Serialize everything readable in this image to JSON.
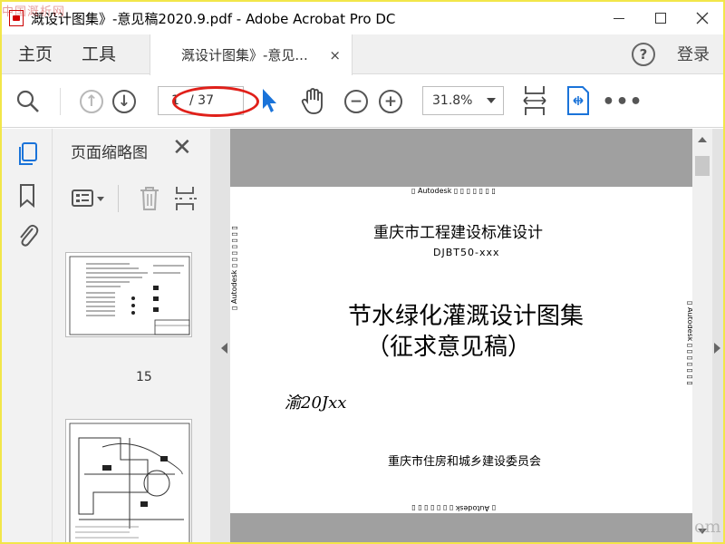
{
  "window": {
    "title": "溉设计图集》-意见稿2020.9.pdf - Adobe Acrobat Pro DC",
    "watermark": "中国溉析网"
  },
  "menubar": {
    "home": "主页",
    "tools": "工具",
    "tab_label": "溉设计图集》-意见...",
    "tab_close": "×",
    "help": "?",
    "login": "登录"
  },
  "toolbar": {
    "current_page": "1",
    "total_pages": "/ 37",
    "zoom": "31.8%"
  },
  "thumbnails": {
    "title": "页面缩略图",
    "close": "✕",
    "page_label": "15"
  },
  "pdf": {
    "stamp_top": "▯ Autodesk ▯ ▯ ▯ ▯ ▯ ▯ ▯",
    "stamp_bottom": "▯ Autodesk ▯ ▯ ▯ ▯ ▯ ▯ ▯",
    "stamp_side_left": "▯ Autodesk ▯ ▯ ▯ ▯ ▯ ▯ ▯",
    "stamp_side_right": "▯ Autodesk ▯ ▯ ▯ ▯ ▯ ▯ ▯",
    "heading": "重庆市工程建设标准设计",
    "code": "DJBT50-xxx",
    "title_line1": "节水绿化灌溉设计图集",
    "title_line2": "（征求意见稿）",
    "handwritten": "渝20Jxx",
    "issuer": "重庆市住房和城乡建设委员会"
  },
  "watermark_br": "om",
  "colors": {
    "annotation": "#e0201a",
    "accent_blue": "#1a73d9",
    "frame": "#f2e64a"
  }
}
